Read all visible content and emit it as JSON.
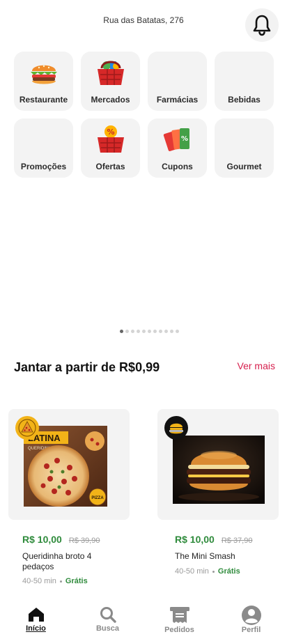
{
  "header": {
    "address": "Rua das Batatas, 276",
    "notification_icon": "bell-icon"
  },
  "categories": [
    {
      "label": "Restaurante",
      "icon": "burger-icon"
    },
    {
      "label": "Mercados",
      "icon": "basket-icon"
    },
    {
      "label": "Farmácias",
      "icon": ""
    },
    {
      "label": "Bebidas",
      "icon": ""
    },
    {
      "label": "Promoções",
      "icon": ""
    },
    {
      "label": "Ofertas",
      "icon": "basket-percent-icon"
    },
    {
      "label": "Cupons",
      "icon": "coupons-icon"
    },
    {
      "label": "Gourmet",
      "icon": ""
    }
  ],
  "carousel": {
    "page_count": 11,
    "active_index": 0
  },
  "section": {
    "title": "Jantar a partir de R$0,99",
    "see_more": "Ver mais"
  },
  "products": [
    {
      "price": "R$ 10,00",
      "old_price": "R$ 39,90",
      "name": "Queridinha broto 4 pedaços",
      "time": "40-50 min",
      "delivery": "Grátis",
      "brand_text": "LATINA",
      "brand_sub": "QUERIDINHA",
      "logo_icon": "pizza-logo-icon"
    },
    {
      "price": "R$ 10,00",
      "old_price": "R$ 37,90",
      "name": "The Mini Smash",
      "time": "40-50 min",
      "delivery": "Grátis",
      "logo_icon": "burger-logo-icon"
    }
  ],
  "bottom_nav": [
    {
      "label": "Início",
      "icon": "home-icon",
      "active": true
    },
    {
      "label": "Busca",
      "icon": "search-icon",
      "active": false
    },
    {
      "label": "Pedidos",
      "icon": "receipt-icon",
      "active": false
    },
    {
      "label": "Perfil",
      "icon": "user-icon",
      "active": false
    }
  ],
  "colors": {
    "accent": "#d6204e",
    "price_green": "#2f8b3c",
    "tile_bg": "#f3f3f3"
  }
}
